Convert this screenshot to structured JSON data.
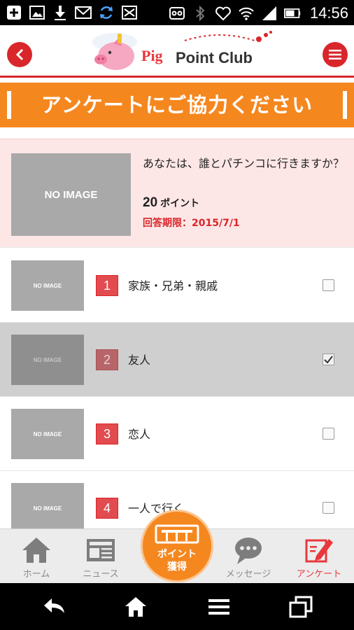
{
  "status_bar": {
    "time": "14:56",
    "left_icons": [
      "add-icon",
      "image-icon",
      "download-icon",
      "mail-icon",
      "sync-icon",
      "inbox-icon"
    ],
    "right_icons": [
      "voicemail-icon",
      "bluetooth-icon",
      "heart-icon",
      "wifi-icon",
      "signal-icon",
      "battery-icon"
    ]
  },
  "header": {
    "logo_pig": "Pig",
    "logo_text": "Point Club",
    "back_icon": "back-arrow-icon",
    "menu_icon": "hamburger-menu-icon"
  },
  "banner": {
    "title": "アンケートにご協力ください"
  },
  "question": {
    "image_placeholder": "NO IMAGE",
    "text": "あなたは、誰とパチンコに行きますか？",
    "points": "20",
    "points_unit": "ポイント",
    "deadline": "回答期限：2015/7/1"
  },
  "answers": [
    {
      "number": "1",
      "label": "家族・兄弟・親戚",
      "image_placeholder": "NO IMAGE",
      "checked": false
    },
    {
      "number": "2",
      "label": "友人",
      "image_placeholder": "NO IMAGE",
      "checked": true
    },
    {
      "number": "3",
      "label": "恋人",
      "image_placeholder": "NO IMAGE",
      "checked": false
    },
    {
      "number": "4",
      "label": "一人で行く",
      "image_placeholder": "NO IMAGE",
      "checked": false
    }
  ],
  "bottom_nav": {
    "home": "ホーム",
    "news": "ニュース",
    "points_line1": "ポイント",
    "points_line2": "獲得",
    "messages": "メッセージ",
    "survey": "アンケート"
  },
  "colors": {
    "brand_red": "#d9262b",
    "banner_orange": "#f5871f",
    "question_bg": "#fde7e6"
  }
}
